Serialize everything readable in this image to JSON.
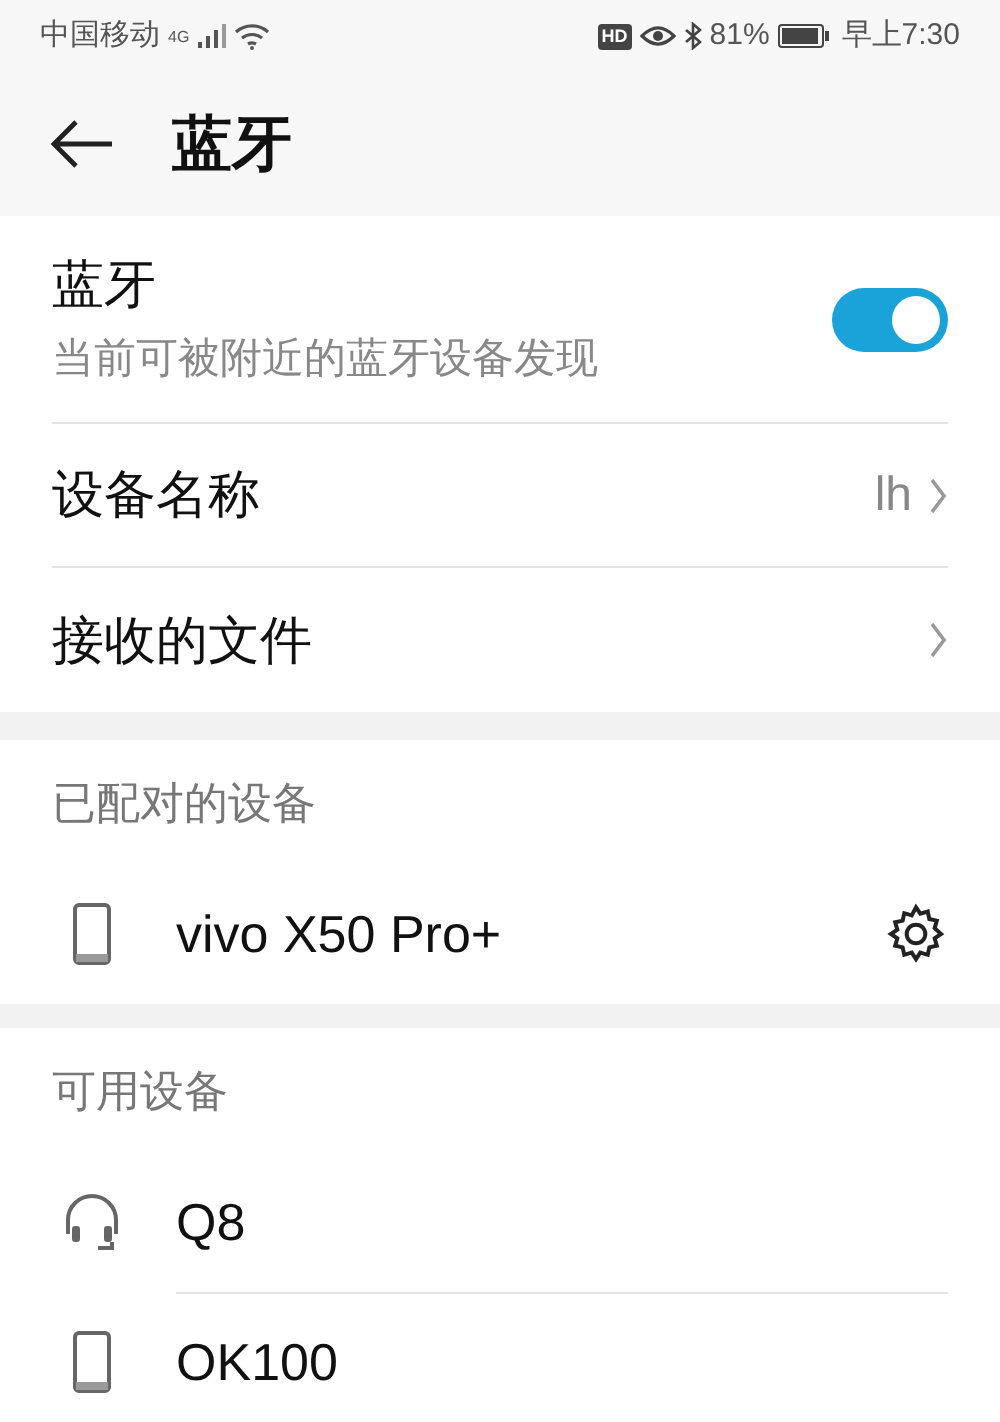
{
  "status_bar": {
    "carrier": "中国移动",
    "network": "4G",
    "hd": "HD",
    "battery": "81%",
    "time": "早上7:30"
  },
  "header": {
    "title": "蓝牙"
  },
  "bluetooth": {
    "label": "蓝牙",
    "subtitle": "当前可被附近的蓝牙设备发现",
    "on": true
  },
  "settings": [
    {
      "label": "设备名称",
      "value": "lh"
    },
    {
      "label": "接收的文件"
    }
  ],
  "paired": {
    "heading": "已配对的设备",
    "devices": [
      {
        "name": "vivo X50 Pro+",
        "kind": "phone"
      }
    ]
  },
  "available": {
    "heading": "可用设备",
    "devices": [
      {
        "name": "Q8",
        "kind": "headset"
      },
      {
        "name": "OK100",
        "kind": "phone"
      }
    ]
  }
}
